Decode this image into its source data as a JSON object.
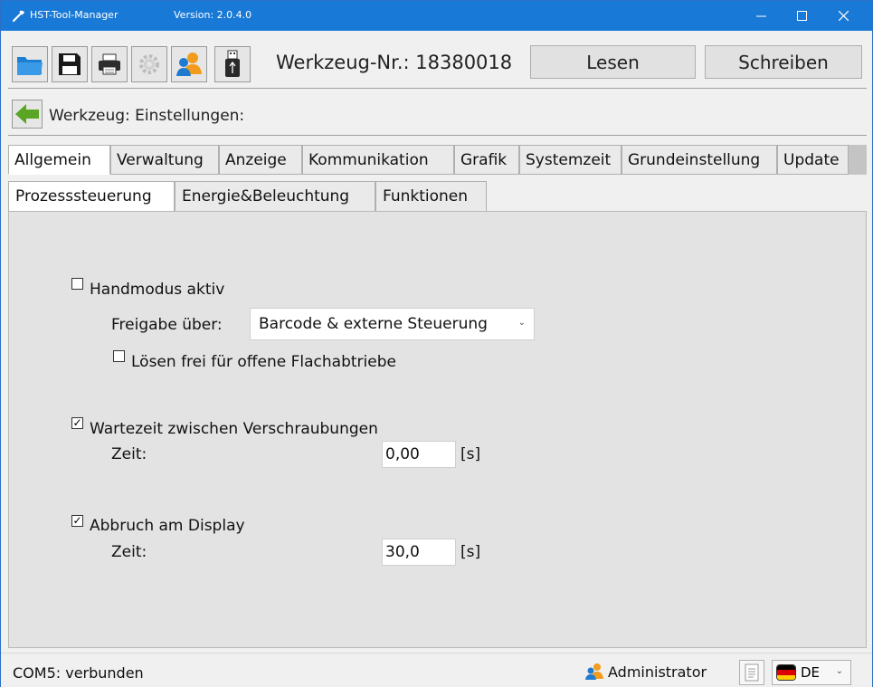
{
  "window": {
    "title": "HST-Tool-Manager",
    "version": "Version: 2.0.4.0",
    "controls": {
      "minimize": "—",
      "maximize": "☐",
      "close": "✕"
    }
  },
  "toolbar": {
    "icons": [
      "open-folder-icon",
      "save-icon",
      "print-icon",
      "settings-gear-icon",
      "user-icon",
      "usb-drive-icon"
    ],
    "werkzeug_nr": "Werkzeug-Nr.: 18380018",
    "lesen_label": "Lesen",
    "schreiben_label": "Schreiben"
  },
  "breadcrumb": {
    "title": "Werkzeug: Einstellungen:"
  },
  "tabs": [
    {
      "label": "Allgemein",
      "active": true
    },
    {
      "label": "Verwaltung",
      "active": false
    },
    {
      "label": "Anzeige",
      "active": false
    },
    {
      "label": "Kommunikation",
      "active": false
    },
    {
      "label": "Grafik",
      "active": false
    },
    {
      "label": "Systemzeit",
      "active": false
    },
    {
      "label": "Grundeinstellung",
      "active": false
    },
    {
      "label": "Update",
      "active": false
    }
  ],
  "subtabs": [
    {
      "label": "Prozesssteuerung",
      "active": true
    },
    {
      "label": "Energie&Beleuchtung",
      "active": false
    },
    {
      "label": "Funktionen",
      "active": false
    }
  ],
  "settings": {
    "handmodus": {
      "label": "Handmodus aktiv",
      "checked": false
    },
    "freigabe": {
      "label": "Freigabe über:",
      "value": "Barcode & externe Steuerung"
    },
    "loesen": {
      "label": "Lösen frei für offene Flachabtriebe",
      "checked": false
    },
    "wartezeit": {
      "label": "Wartezeit zwischen Verschraubungen",
      "checked": true,
      "zeit_label": "Zeit:",
      "value": "0,00",
      "unit": "[s]"
    },
    "abbruch": {
      "label": "Abbruch am Display",
      "checked": true,
      "zeit_label": "Zeit:",
      "value": "30,0",
      "unit": "[s]"
    }
  },
  "statusbar": {
    "connection": "COM5: verbunden",
    "user": "Administrator",
    "language": "DE"
  },
  "colors": {
    "titlebar": "#1979d6",
    "panel": "#e3e3e3",
    "accent_green": "#4a9a1e"
  }
}
